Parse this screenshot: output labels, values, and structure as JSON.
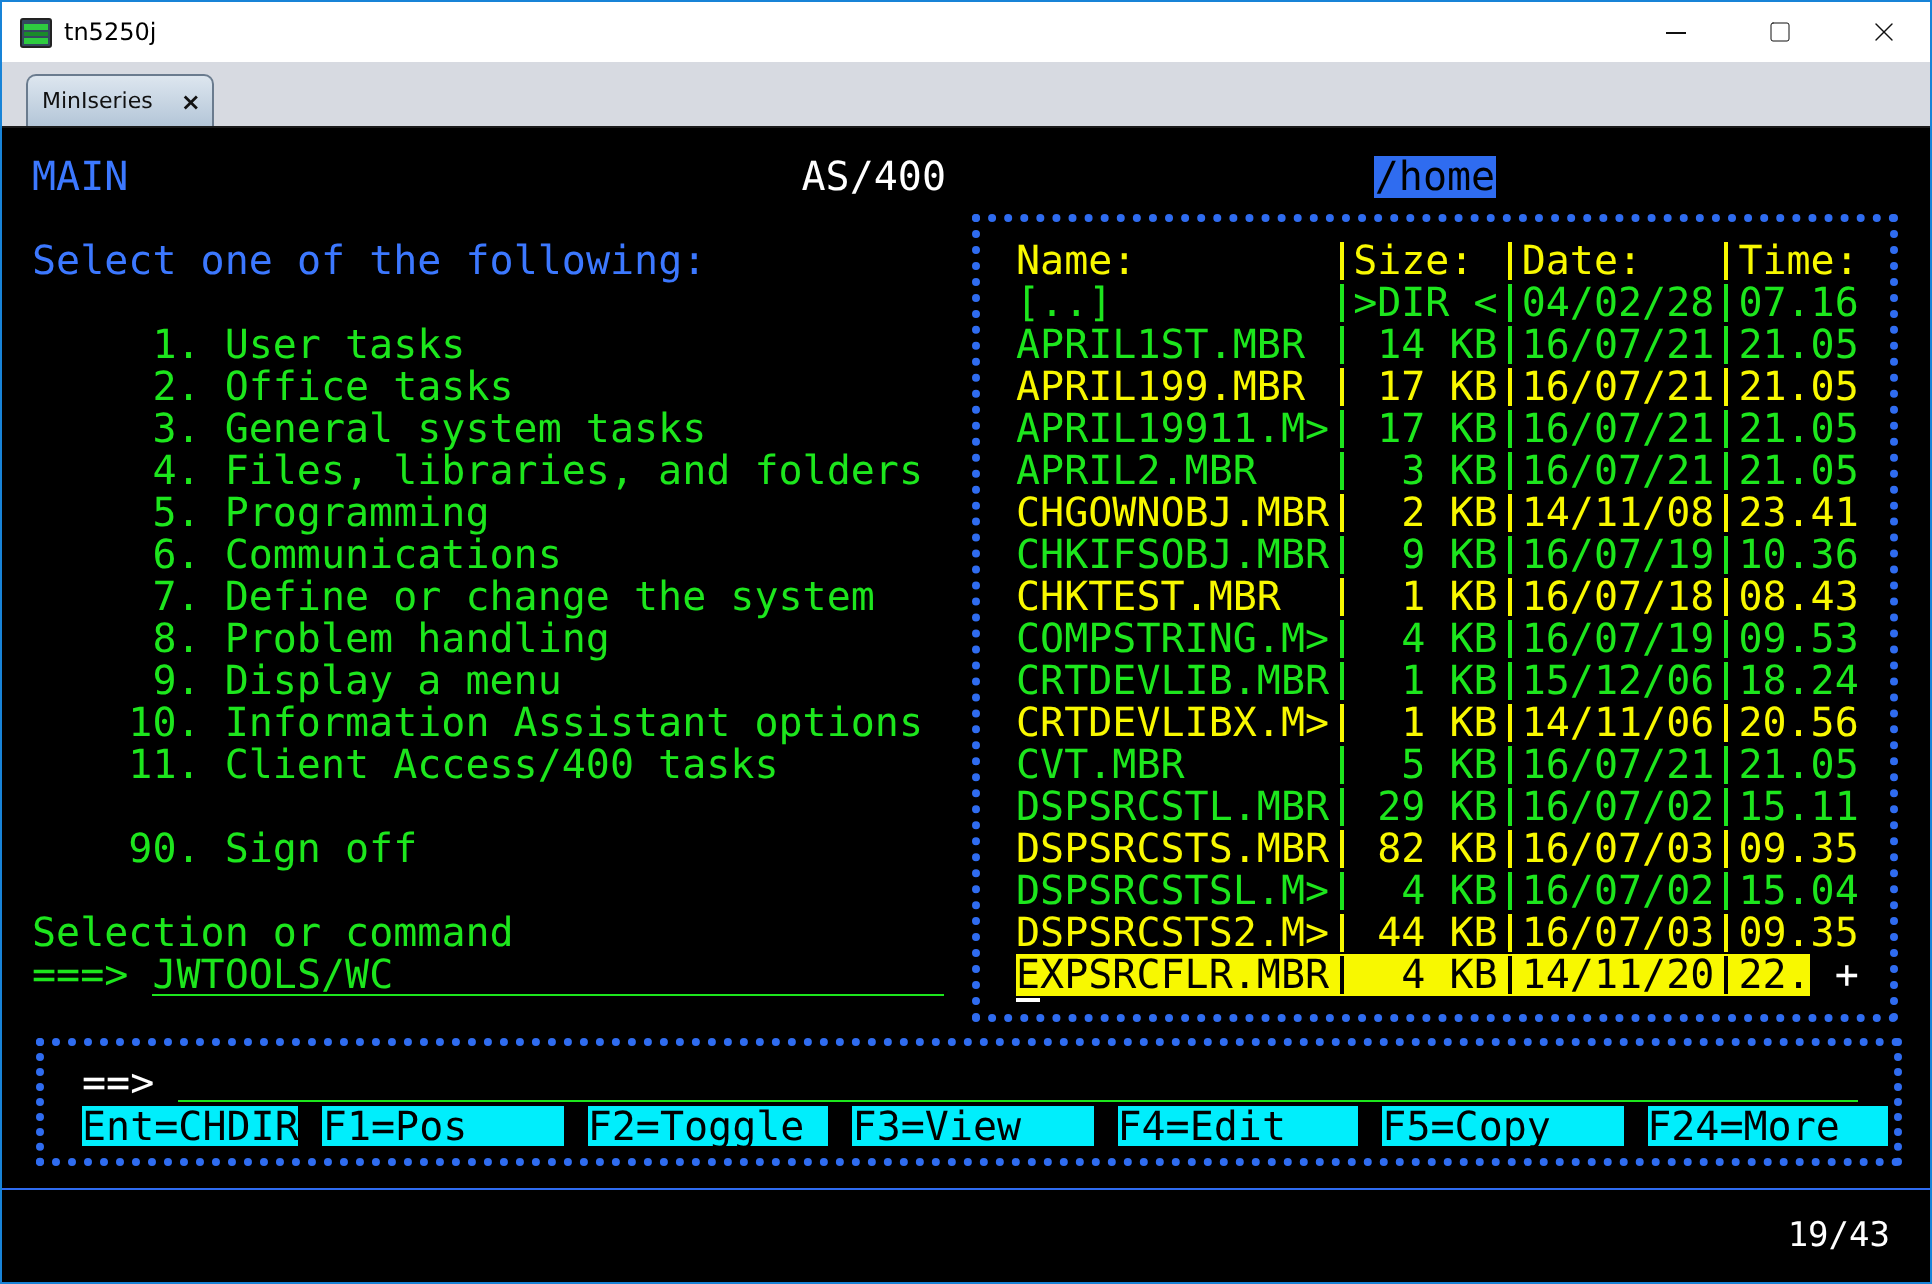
{
  "window": {
    "title": "tn5250j"
  },
  "tabs": [
    {
      "label": "MinIseries",
      "close": "×",
      "selected": true
    }
  ],
  "screen": {
    "title": "MAIN",
    "system": "AS/400",
    "prompt": "Select one of the following:",
    "options": [
      {
        "number": "1.",
        "label": "User tasks"
      },
      {
        "number": "2.",
        "label": "Office tasks"
      },
      {
        "number": "3.",
        "label": "General system tasks"
      },
      {
        "number": "4.",
        "label": "Files, libraries, and folders"
      },
      {
        "number": "5.",
        "label": "Programming"
      },
      {
        "number": "6.",
        "label": "Communications"
      },
      {
        "number": "7.",
        "label": "Define or change the system"
      },
      {
        "number": "8.",
        "label": "Problem handling"
      },
      {
        "number": "9.",
        "label": "Display a menu"
      },
      {
        "number": "10.",
        "label": "Information Assistant options"
      },
      {
        "number": "11.",
        "label": "Client Access/400 tasks"
      }
    ],
    "exit_option": {
      "number": "90.",
      "label": "Sign off"
    },
    "command": {
      "label": "Selection or command",
      "arrow": "===>",
      "value": "JWTOOLS/WC"
    }
  },
  "file_browser": {
    "path": "/home",
    "columns": [
      "Name:",
      "Size:",
      "Date:",
      "Time:"
    ],
    "rows": [
      {
        "name": "[..]",
        "size": ">DIR <",
        "date": "04/02/28",
        "time": "07.16",
        "color": "#1de61d",
        "selected": false
      },
      {
        "name": "APRIL1ST.MBR",
        "size": "14 KB",
        "date": "16/07/21",
        "time": "21.05",
        "color": "#1de61d",
        "selected": false
      },
      {
        "name": "APRIL199.MBR",
        "size": "17 KB",
        "date": "16/07/21",
        "time": "21.05",
        "color": "#f8f800",
        "selected": false
      },
      {
        "name": "APRIL19911.M>",
        "size": "17 KB",
        "date": "16/07/21",
        "time": "21.05",
        "color": "#1de61d",
        "selected": false
      },
      {
        "name": "APRIL2.MBR",
        "size": "3 KB",
        "date": "16/07/21",
        "time": "21.05",
        "color": "#1de61d",
        "selected": false
      },
      {
        "name": "CHGOWNOBJ.MBR",
        "size": "2 KB",
        "date": "14/11/08",
        "time": "23.41",
        "color": "#f8f800",
        "selected": false
      },
      {
        "name": "CHKIFSOBJ.MBR",
        "size": "9 KB",
        "date": "16/07/19",
        "time": "10.36",
        "color": "#1de61d",
        "selected": false
      },
      {
        "name": "CHKTEST.MBR",
        "size": "1 KB",
        "date": "16/07/18",
        "time": "08.43",
        "color": "#f8f800",
        "selected": false
      },
      {
        "name": "COMPSTRING.M>",
        "size": "4 KB",
        "date": "16/07/19",
        "time": "09.53",
        "color": "#1de61d",
        "selected": false
      },
      {
        "name": "CRTDEVLIB.MBR",
        "size": "1 KB",
        "date": "15/12/06",
        "time": "18.24",
        "color": "#1de61d",
        "selected": false
      },
      {
        "name": "CRTDEVLIBX.M>",
        "size": "1 KB",
        "date": "14/11/06",
        "time": "20.56",
        "color": "#f8f800",
        "selected": false
      },
      {
        "name": "CVT.MBR",
        "size": "5 KB",
        "date": "16/07/21",
        "time": "21.05",
        "color": "#1de61d",
        "selected": false
      },
      {
        "name": "DSPSRCSTL.MBR",
        "size": "29 KB",
        "date": "16/07/02",
        "time": "15.11",
        "color": "#1de61d",
        "selected": false
      },
      {
        "name": "DSPSRCSTS.MBR",
        "size": "82 KB",
        "date": "16/07/03",
        "time": "09.35",
        "color": "#f8f800",
        "selected": false
      },
      {
        "name": "DSPSRCSTSL.M>",
        "size": "4 KB",
        "date": "16/07/02",
        "time": "15.04",
        "color": "#1de61d",
        "selected": false
      },
      {
        "name": "DSPSRCSTS2.M>",
        "size": "44 KB",
        "date": "16/07/03",
        "time": "09.35",
        "color": "#f8f800",
        "selected": false
      },
      {
        "name": "EXPSRCFLR.MBR",
        "size": "4 KB",
        "date": "14/11/20",
        "time": "22.",
        "color": "#f8f800",
        "selected": true
      }
    ],
    "more_indicator": "+"
  },
  "command_line": {
    "arrow": "==>"
  },
  "function_keys": [
    "Ent=CHDIR",
    "F1=Pos",
    "F2=Toggle",
    "F3=View",
    "F4=Edit",
    "F5=Copy",
    "F24=More"
  ],
  "status_bar": {
    "position": "19/43"
  }
}
